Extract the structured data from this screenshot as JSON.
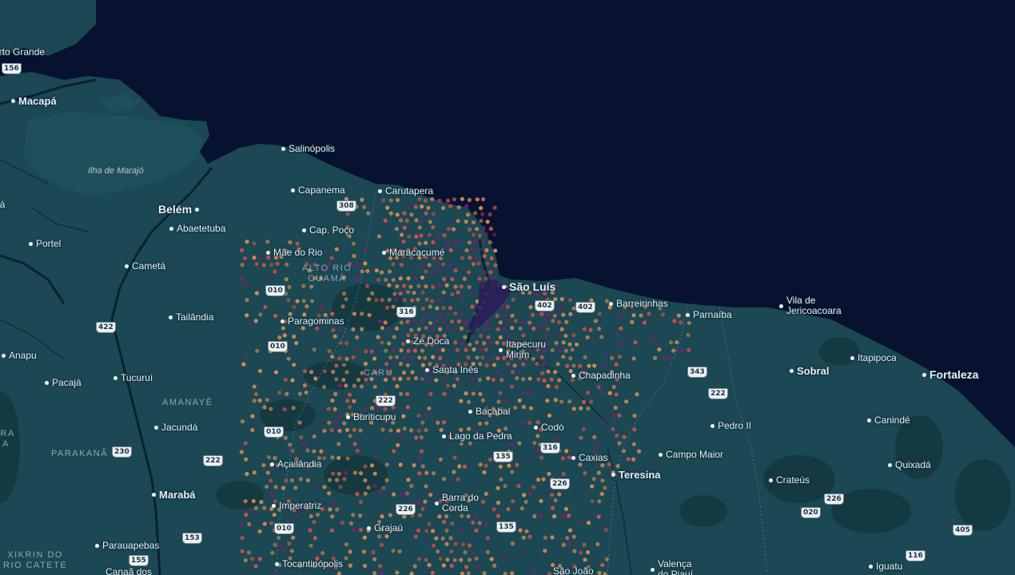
{
  "map": {
    "colors": {
      "ocean": "#061230",
      "land": "#1b4852",
      "land_dark": "#14383f",
      "heat_low": "#e08f56",
      "heat_mid": "#d9534f",
      "heat_high": "#7a1f6e"
    },
    "cities": [
      {
        "name": "orto Grande",
        "tier": "minor",
        "nodot": true
      },
      {
        "name": "Macapá",
        "tier": "mid"
      },
      {
        "name": "Salinópolis",
        "tier": "minor"
      },
      {
        "name": "Capanema",
        "tier": "minor"
      },
      {
        "name": "Carutapera",
        "tier": "minor"
      },
      {
        "name": "Belém",
        "tier": "major"
      },
      {
        "name": "Abaetetuba",
        "tier": "minor"
      },
      {
        "name": "Cap. Poço",
        "tier": "minor"
      },
      {
        "name": "Portel",
        "tier": "minor"
      },
      {
        "name": "Mãe do Rio",
        "tier": "minor"
      },
      {
        "name": "Maracaçumé",
        "tier": "minor"
      },
      {
        "name": "Cametá",
        "tier": "minor"
      },
      {
        "name": "São Luís",
        "tier": "major"
      },
      {
        "name": "Barreirinhas",
        "tier": "minor"
      },
      {
        "name": "Parnaíba",
        "tier": "minor"
      },
      {
        "name": "Vila de\nJericoacoara",
        "tier": "minor"
      },
      {
        "name": "Tailândia",
        "tier": "minor"
      },
      {
        "name": "Paragominas",
        "tier": "minor"
      },
      {
        "name": "Zé Doca",
        "tier": "minor"
      },
      {
        "name": "Itapecuru\nMirim",
        "tier": "minor"
      },
      {
        "name": "Itapipoca",
        "tier": "minor"
      },
      {
        "name": "Anapu",
        "tier": "minor"
      },
      {
        "name": "Santa Inês",
        "tier": "minor"
      },
      {
        "name": "Chapadinha",
        "tier": "minor"
      },
      {
        "name": "Sobral",
        "tier": "mid"
      },
      {
        "name": "Fortaleza",
        "tier": "major"
      },
      {
        "name": "Tucuruí",
        "tier": "minor"
      },
      {
        "name": "Pacajá",
        "tier": "minor"
      },
      {
        "name": "Buriticupu",
        "tier": "minor"
      },
      {
        "name": "Bacabal",
        "tier": "minor"
      },
      {
        "name": "Canindé",
        "tier": "minor"
      },
      {
        "name": "Jacundá",
        "tier": "minor"
      },
      {
        "name": "Codó",
        "tier": "minor"
      },
      {
        "name": "Pedro II",
        "tier": "minor"
      },
      {
        "name": "Lago da Pedra",
        "tier": "minor"
      },
      {
        "name": "Caxias",
        "tier": "minor"
      },
      {
        "name": "Campo Maior",
        "tier": "minor"
      },
      {
        "name": "Açailândia",
        "tier": "minor"
      },
      {
        "name": "Quixadá",
        "tier": "minor"
      },
      {
        "name": "Teresina",
        "tier": "mid"
      },
      {
        "name": "Crateús",
        "tier": "minor"
      },
      {
        "name": "Marabá",
        "tier": "mid"
      },
      {
        "name": "Imperatriz",
        "tier": "minor"
      },
      {
        "name": "Barra do\nCorda",
        "tier": "minor"
      },
      {
        "name": "Grajaú",
        "tier": "minor"
      },
      {
        "name": "Parauapebas",
        "tier": "minor"
      },
      {
        "name": "Tocantinópolis",
        "tier": "minor"
      },
      {
        "name": "Iguatu",
        "tier": "minor"
      },
      {
        "name": "Canaã dos",
        "tier": "minor",
        "nodot": true
      },
      {
        "name": "São João",
        "tier": "minor",
        "nodot": true
      },
      {
        "name": "Valença\ndo Piauí",
        "tier": "minor"
      },
      {
        "name": "pá",
        "tier": "minor"
      }
    ],
    "regions": [
      "Ilha de Marajó",
      "ALTO RIO\nGUAMÁ",
      "CARU",
      "AMANAYÉ",
      "PARAKANÃ",
      "XIKRIN DO\nRIO CATETE",
      "IRA\nA"
    ],
    "shields": [
      "156",
      "308",
      "010",
      "316",
      "402",
      "402",
      "422",
      "010",
      "343",
      "222",
      "222",
      "010",
      "316",
      "135",
      "230",
      "222",
      "226",
      "020",
      "226",
      "226",
      "010",
      "153",
      "135",
      "405",
      "155",
      "116"
    ]
  }
}
